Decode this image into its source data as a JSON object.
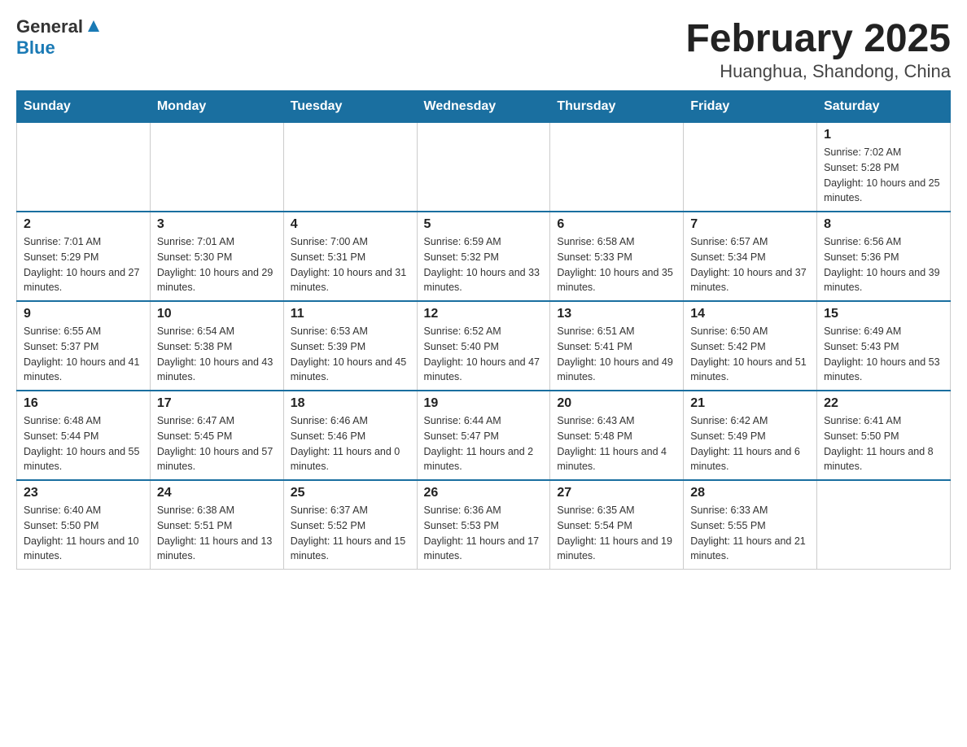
{
  "logo": {
    "text_general": "General",
    "text_blue": "Blue"
  },
  "title": "February 2025",
  "subtitle": "Huanghua, Shandong, China",
  "days_of_week": [
    "Sunday",
    "Monday",
    "Tuesday",
    "Wednesday",
    "Thursday",
    "Friday",
    "Saturday"
  ],
  "weeks": [
    {
      "days": [
        {
          "number": "",
          "info": ""
        },
        {
          "number": "",
          "info": ""
        },
        {
          "number": "",
          "info": ""
        },
        {
          "number": "",
          "info": ""
        },
        {
          "number": "",
          "info": ""
        },
        {
          "number": "",
          "info": ""
        },
        {
          "number": "1",
          "info": "Sunrise: 7:02 AM\nSunset: 5:28 PM\nDaylight: 10 hours and 25 minutes."
        }
      ]
    },
    {
      "days": [
        {
          "number": "2",
          "info": "Sunrise: 7:01 AM\nSunset: 5:29 PM\nDaylight: 10 hours and 27 minutes."
        },
        {
          "number": "3",
          "info": "Sunrise: 7:01 AM\nSunset: 5:30 PM\nDaylight: 10 hours and 29 minutes."
        },
        {
          "number": "4",
          "info": "Sunrise: 7:00 AM\nSunset: 5:31 PM\nDaylight: 10 hours and 31 minutes."
        },
        {
          "number": "5",
          "info": "Sunrise: 6:59 AM\nSunset: 5:32 PM\nDaylight: 10 hours and 33 minutes."
        },
        {
          "number": "6",
          "info": "Sunrise: 6:58 AM\nSunset: 5:33 PM\nDaylight: 10 hours and 35 minutes."
        },
        {
          "number": "7",
          "info": "Sunrise: 6:57 AM\nSunset: 5:34 PM\nDaylight: 10 hours and 37 minutes."
        },
        {
          "number": "8",
          "info": "Sunrise: 6:56 AM\nSunset: 5:36 PM\nDaylight: 10 hours and 39 minutes."
        }
      ]
    },
    {
      "days": [
        {
          "number": "9",
          "info": "Sunrise: 6:55 AM\nSunset: 5:37 PM\nDaylight: 10 hours and 41 minutes."
        },
        {
          "number": "10",
          "info": "Sunrise: 6:54 AM\nSunset: 5:38 PM\nDaylight: 10 hours and 43 minutes."
        },
        {
          "number": "11",
          "info": "Sunrise: 6:53 AM\nSunset: 5:39 PM\nDaylight: 10 hours and 45 minutes."
        },
        {
          "number": "12",
          "info": "Sunrise: 6:52 AM\nSunset: 5:40 PM\nDaylight: 10 hours and 47 minutes."
        },
        {
          "number": "13",
          "info": "Sunrise: 6:51 AM\nSunset: 5:41 PM\nDaylight: 10 hours and 49 minutes."
        },
        {
          "number": "14",
          "info": "Sunrise: 6:50 AM\nSunset: 5:42 PM\nDaylight: 10 hours and 51 minutes."
        },
        {
          "number": "15",
          "info": "Sunrise: 6:49 AM\nSunset: 5:43 PM\nDaylight: 10 hours and 53 minutes."
        }
      ]
    },
    {
      "days": [
        {
          "number": "16",
          "info": "Sunrise: 6:48 AM\nSunset: 5:44 PM\nDaylight: 10 hours and 55 minutes."
        },
        {
          "number": "17",
          "info": "Sunrise: 6:47 AM\nSunset: 5:45 PM\nDaylight: 10 hours and 57 minutes."
        },
        {
          "number": "18",
          "info": "Sunrise: 6:46 AM\nSunset: 5:46 PM\nDaylight: 11 hours and 0 minutes."
        },
        {
          "number": "19",
          "info": "Sunrise: 6:44 AM\nSunset: 5:47 PM\nDaylight: 11 hours and 2 minutes."
        },
        {
          "number": "20",
          "info": "Sunrise: 6:43 AM\nSunset: 5:48 PM\nDaylight: 11 hours and 4 minutes."
        },
        {
          "number": "21",
          "info": "Sunrise: 6:42 AM\nSunset: 5:49 PM\nDaylight: 11 hours and 6 minutes."
        },
        {
          "number": "22",
          "info": "Sunrise: 6:41 AM\nSunset: 5:50 PM\nDaylight: 11 hours and 8 minutes."
        }
      ]
    },
    {
      "days": [
        {
          "number": "23",
          "info": "Sunrise: 6:40 AM\nSunset: 5:50 PM\nDaylight: 11 hours and 10 minutes."
        },
        {
          "number": "24",
          "info": "Sunrise: 6:38 AM\nSunset: 5:51 PM\nDaylight: 11 hours and 13 minutes."
        },
        {
          "number": "25",
          "info": "Sunrise: 6:37 AM\nSunset: 5:52 PM\nDaylight: 11 hours and 15 minutes."
        },
        {
          "number": "26",
          "info": "Sunrise: 6:36 AM\nSunset: 5:53 PM\nDaylight: 11 hours and 17 minutes."
        },
        {
          "number": "27",
          "info": "Sunrise: 6:35 AM\nSunset: 5:54 PM\nDaylight: 11 hours and 19 minutes."
        },
        {
          "number": "28",
          "info": "Sunrise: 6:33 AM\nSunset: 5:55 PM\nDaylight: 11 hours and 21 minutes."
        },
        {
          "number": "",
          "info": ""
        }
      ]
    }
  ]
}
